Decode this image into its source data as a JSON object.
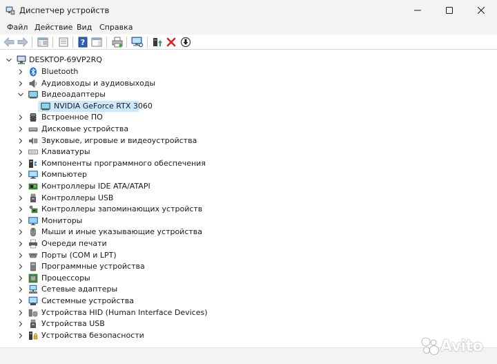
{
  "window": {
    "title": "Диспетчер устройств"
  },
  "menu": {
    "items": [
      "Файл",
      "Действие",
      "Вид",
      "Справка"
    ]
  },
  "toolbar": {
    "buttons": [
      "back-icon",
      "forward-icon",
      "show-hide-console-tree-icon",
      "properties-icon",
      "help-icon",
      "action-pane-icon",
      "print-icon",
      "scan-hardware-icon",
      "enable-device-icon",
      "uninstall-device-icon",
      "update-driver-icon"
    ]
  },
  "tree": {
    "root": "DESKTOP-69VP2RQ",
    "categories": [
      {
        "label": "Bluetooth",
        "icon": "bluetooth-icon",
        "expanded": false
      },
      {
        "label": "Аудиовходы и аудиовыходы",
        "icon": "speaker-icon",
        "expanded": false
      },
      {
        "label": "Видеоадаптеры",
        "icon": "display-adapter-icon",
        "expanded": true,
        "children": [
          "NVIDIA GeForce RTX 3060"
        ]
      },
      {
        "label": "Встроенное ПО",
        "icon": "firmware-icon",
        "expanded": false
      },
      {
        "label": "Дисковые устройства",
        "icon": "disk-drive-icon",
        "expanded": false
      },
      {
        "label": "Звуковые, игровые и видеоустройства",
        "icon": "sound-device-icon",
        "expanded": false
      },
      {
        "label": "Клавиатуры",
        "icon": "keyboard-icon",
        "expanded": false
      },
      {
        "label": "Компоненты программного обеспечения",
        "icon": "software-component-icon",
        "expanded": false
      },
      {
        "label": "Компьютер",
        "icon": "computer-icon",
        "expanded": false
      },
      {
        "label": "Контроллеры IDE ATA/ATAPI",
        "icon": "ide-controller-icon",
        "expanded": false
      },
      {
        "label": "Контроллеры USB",
        "icon": "usb-controller-icon",
        "expanded": false
      },
      {
        "label": "Контроллеры запоминающих устройств",
        "icon": "storage-controller-icon",
        "expanded": false
      },
      {
        "label": "Мониторы",
        "icon": "monitor-icon",
        "expanded": false
      },
      {
        "label": "Мыши и иные указывающие устройства",
        "icon": "mouse-icon",
        "expanded": false
      },
      {
        "label": "Очереди печати",
        "icon": "printer-icon",
        "expanded": false
      },
      {
        "label": "Порты (COM и LPT)",
        "icon": "port-icon",
        "expanded": false
      },
      {
        "label": "Программные устройства",
        "icon": "software-device-icon",
        "expanded": false
      },
      {
        "label": "Процессоры",
        "icon": "processor-icon",
        "expanded": false
      },
      {
        "label": "Сетевые адаптеры",
        "icon": "network-adapter-icon",
        "expanded": false
      },
      {
        "label": "Системные устройства",
        "icon": "system-device-icon",
        "expanded": false
      },
      {
        "label": "Устройства HID (Human Interface Devices)",
        "icon": "hid-icon",
        "expanded": false
      },
      {
        "label": "Устройства USB",
        "icon": "usb-device-icon",
        "expanded": false
      },
      {
        "label": "Устройства безопасности",
        "icon": "security-device-icon",
        "expanded": false
      }
    ]
  },
  "watermark": {
    "text": "Avito"
  },
  "colors": {
    "selection": "#cce8ff",
    "chrome": "#f3f3f3",
    "uninstall_red": "#d62020",
    "accent_blue": "#2f6fd6"
  }
}
